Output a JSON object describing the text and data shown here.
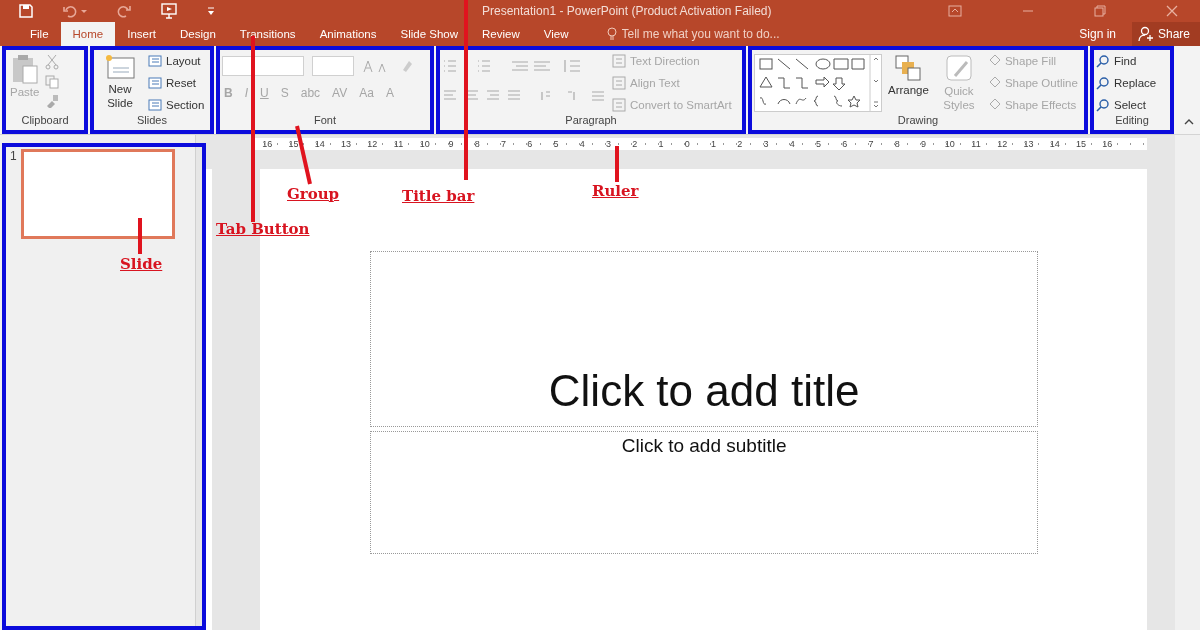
{
  "title_bar": {
    "title": "Presentation1 - PowerPoint (Product Activation Failed)"
  },
  "tabs": [
    {
      "label": "File",
      "selected": false
    },
    {
      "label": "Home",
      "selected": true
    },
    {
      "label": "Insert",
      "selected": false
    },
    {
      "label": "Design",
      "selected": false
    },
    {
      "label": "Transitions",
      "selected": false
    },
    {
      "label": "Animations",
      "selected": false
    },
    {
      "label": "Slide Show",
      "selected": false
    },
    {
      "label": "Review",
      "selected": false
    },
    {
      "label": "View",
      "selected": false
    }
  ],
  "tell_me": {
    "placeholder": "Tell me what you want to do..."
  },
  "account": {
    "sign_in": "Sign in",
    "share": "Share"
  },
  "ribbon": [
    {
      "kind": "clipboard",
      "label": "Clipboard",
      "commands": [
        {
          "label": "Paste",
          "disabled": true
        }
      ]
    },
    {
      "kind": "slides",
      "label": "Slides",
      "commands": [
        {
          "label": "New Slide",
          "disabled": false
        },
        {
          "label": "Layout",
          "disabled": false
        },
        {
          "label": "Reset",
          "disabled": false
        },
        {
          "label": "Section",
          "disabled": false
        }
      ]
    },
    {
      "kind": "font",
      "label": "Font",
      "commands": [
        {
          "label": "B",
          "disabled": true
        },
        {
          "label": "I",
          "disabled": true
        },
        {
          "label": "U",
          "disabled": true
        },
        {
          "label": "S",
          "disabled": true
        },
        {
          "label": "abc",
          "disabled": true
        },
        {
          "label": "AV",
          "disabled": true
        },
        {
          "label": "Aa",
          "disabled": true
        },
        {
          "label": "A",
          "disabled": true
        }
      ]
    },
    {
      "kind": "paragraph",
      "label": "Paragraph",
      "commands": [
        {
          "label": "Text Direction",
          "disabled": true
        },
        {
          "label": "Align Text",
          "disabled": true
        },
        {
          "label": "Convert to SmartArt",
          "disabled": true
        }
      ]
    },
    {
      "kind": "drawing",
      "label": "Drawing",
      "commands": [
        {
          "label": "Arrange",
          "disabled": false
        },
        {
          "label": "Quick Styles",
          "disabled": true
        },
        {
          "label": "Shape Fill",
          "disabled": true
        },
        {
          "label": "Shape Outline",
          "disabled": true
        },
        {
          "label": "Shape Effects",
          "disabled": true
        }
      ]
    },
    {
      "kind": "editing",
      "label": "Editing",
      "commands": [
        {
          "label": "Find",
          "disabled": false
        },
        {
          "label": "Replace",
          "disabled": false
        },
        {
          "label": "Select",
          "disabled": false
        }
      ]
    }
  ],
  "ruler": {
    "labels": [
      "16",
      "15",
      "14",
      "13",
      "12",
      "11",
      "10",
      "9",
      "8",
      "7",
      "6",
      "5",
      "4",
      "3",
      "2",
      "1",
      "0",
      "1",
      "2",
      "3",
      "4",
      "5",
      "6",
      "7",
      "8",
      "9",
      "10",
      "11",
      "12",
      "13",
      "14",
      "15",
      "16"
    ]
  },
  "slides_pane": {
    "slides": [
      {
        "number": "1",
        "selected": true
      }
    ]
  },
  "slide": {
    "title_placeholder": "Click to add title",
    "subtitle_placeholder": "Click to add subtitle"
  },
  "annotations": [
    {
      "label": "Tab Button"
    },
    {
      "label": "Group"
    },
    {
      "label": "Title bar"
    },
    {
      "label": "Ruler"
    },
    {
      "label": "Slide"
    }
  ]
}
